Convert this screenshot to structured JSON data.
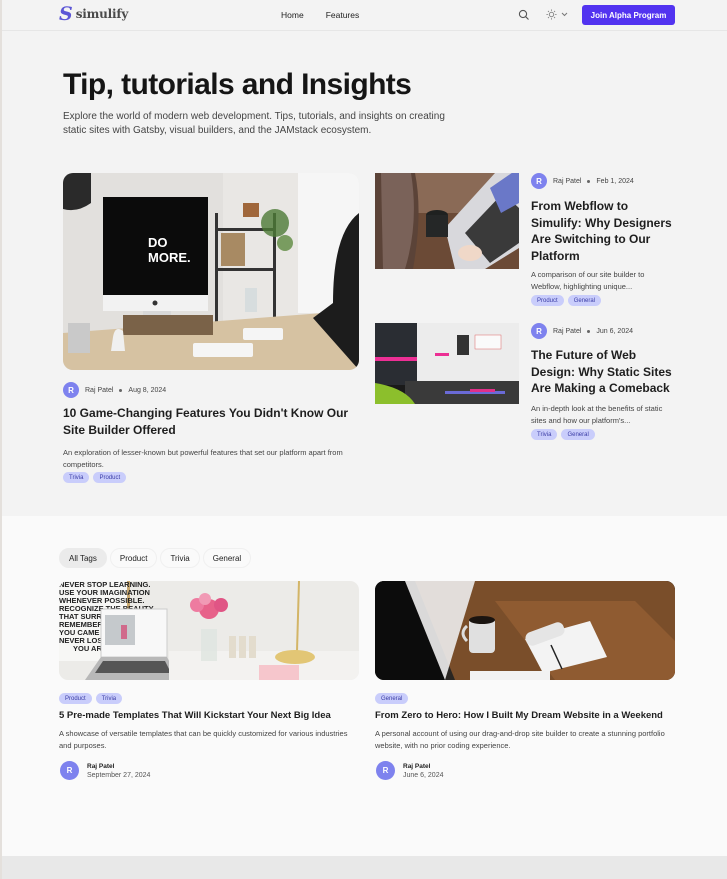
{
  "header": {
    "logo_mark": "S",
    "logo_text": "simulify",
    "nav": [
      "Home",
      "Features"
    ],
    "join_button": "Join Alpha Program",
    "icons": [
      "search-icon",
      "sun-icon",
      "chevron-down-icon"
    ],
    "accent_color": "#5233f0"
  },
  "hero": {
    "title": "Tip, tutorials and Insights",
    "subtitle": "Explore the world of modern web development. Tips, tutorials, and insights on creating static sites with Gatsby, visual builders, and the JAMstack ecosystem."
  },
  "featured": {
    "main": {
      "avatar": "R",
      "author": "Raj Patel",
      "date": "Aug 8, 2024",
      "title": "10 Game-Changing Features You Didn't Know Our Site Builder Offered",
      "description": "An exploration of lesser-known but powerful features that set our platform apart from competitors.",
      "tags": [
        "Trivia",
        "Product"
      ],
      "image_alt": "Desk with iMac showing DO MORE."
    },
    "side": [
      {
        "avatar": "R",
        "author": "Raj Patel",
        "date": "Feb 1, 2024",
        "title": "From Webflow to Simulify: Why Designers Are Switching to Our Platform",
        "description": "A comparison of our site builder to Webflow, highlighting unique...",
        "tags": [
          "Product",
          "General"
        ]
      },
      {
        "avatar": "R",
        "author": "Raj Patel",
        "date": "Jun 6, 2024",
        "title": "The Future of Web Design: Why Static Sites Are Making a Comeback",
        "description": "An in-depth look at the benefits of static sites and how our platform's...",
        "tags": [
          "Trivia",
          "General"
        ]
      }
    ]
  },
  "filters": {
    "items": [
      "All Tags",
      "Product",
      "Trivia",
      "General"
    ],
    "active": "All Tags"
  },
  "cards": [
    {
      "tags": [
        "Product",
        "Trivia"
      ],
      "title": "5 Pre-made Templates That Will Kickstart Your Next Big Idea",
      "description": "A showcase of versatile templates that can be quickly customized for various industries and purposes.",
      "avatar": "R",
      "author": "Raj Patel",
      "date": "September 27, 2024"
    },
    {
      "tags": [
        "General"
      ],
      "title": "From Zero to Hero: How I Built My Dream Website in a Weekend",
      "description": "A personal account of using our drag-and-drop site builder to create a stunning portfolio website, with no prior coding experience.",
      "avatar": "R",
      "author": "Raj Patel",
      "date": "June 6, 2024"
    }
  ],
  "image_text": {
    "monitor": "DO MORE.",
    "poster": [
      "NEVER STOP LEARNING.",
      "USE YOUR IMAGINATION",
      "WHENEVER POSSIBLE.",
      "RECOGNIZE THE BEAUTY",
      "THAT SURROUNDS",
      "REMEMBER WHERE",
      "YOU CAME FROM, BUT",
      "NEVER LOSE SIGHT OF",
      "WHERE YOU ARE GOING"
    ]
  }
}
